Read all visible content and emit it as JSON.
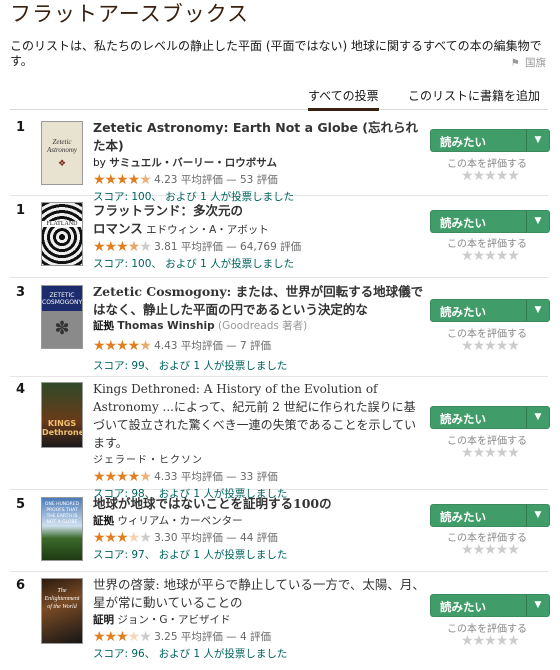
{
  "page": {
    "title": "フラットアースブックス",
    "description": "このリストは、私たちのレベルの静止した平面 (平面ではない) 地球に関するすべての本の編集物です。",
    "report_label": "国旗"
  },
  "tabs": {
    "all_votes": "すべての投票",
    "add_books": "このリストに書籍を追加"
  },
  "buttons": {
    "want_to_read": "読みたい",
    "rate_this_book": "この本を評価する"
  },
  "colors": {
    "star": "#e07e20",
    "button": "#409d69",
    "link": "#00635d"
  },
  "books": [
    {
      "rank": "1",
      "title": "Zetetic Astronomy: Earth Not a Globe (忘れられた本)",
      "by": "by",
      "author": "サミュエル・バーリー・ロウボサム",
      "stars": 4.23,
      "rating": "4.23 平均評価 — 53 評価",
      "score": "スコア: 100、 および 1 人が投票しました",
      "cover_text": "Zetetic Astronomy"
    },
    {
      "rank": "1",
      "title": "フラットランド：多次元の",
      "title2": "ロマンス",
      "author": "エドウィン・A・アボット",
      "stars": 3.81,
      "rating": "3.81 平均評価 — 64,769 評価",
      "score": "スコア: 100、 および 1 人が投票しました",
      "cover_text": "FLATLAND"
    },
    {
      "rank": "3",
      "title": "Zetetic Cosmogony: または、世界が回転する地球儀ではなく、静止した平面の円であるという決定的な",
      "by": "証拠",
      "author": "Thomas Winship",
      "author_note": "(Goodreads 著者)",
      "stars": 4.43,
      "rating": "4.43 平均評価 — 7 評価",
      "score": "スコア: 99、 および 1 人が投票しました",
      "cover_text": "ZETETIC COSMOGONY"
    },
    {
      "rank": "4",
      "title": "Kings Dethroned: A History of the Evolution of Astronomy ...によって、紀元前 2 世紀に作られた誤りに基づいて設立された驚くべき一連の失策であることを示しています。",
      "author": "ジェラード・ヒクソン",
      "stars": 4.33,
      "rating": "4.33 平均評価 — 33 評価",
      "score": "スコア: 98、 および 1 人が投票しました",
      "cover_text": "KINGS Dethroned"
    },
    {
      "rank": "5",
      "title": "地球が地球ではないことを証明する100の",
      "by": "証拠",
      "author": "ウィリアム・カーペンター",
      "stars": 3.3,
      "rating": "3.30 平均評価 — 44 評価",
      "score": "スコア: 97、 および 1 人が投票しました",
      "cover_text": "ONE HUNDRED PROOFS THAT THE EARTH IS NOT A GLOBE"
    },
    {
      "rank": "6",
      "title": "世界の啓蒙: 地球が平らで静止している一方で、太陽、月、星が常に動いていることの",
      "by": "証明",
      "author": "ジョン・G・アビザイド",
      "stars": 3.25,
      "rating": "3.25 平均評価 — 4 評価",
      "score": "スコア: 96、 および 1 人が投票しました",
      "cover_text": "The Enlightenment of the World"
    }
  ]
}
